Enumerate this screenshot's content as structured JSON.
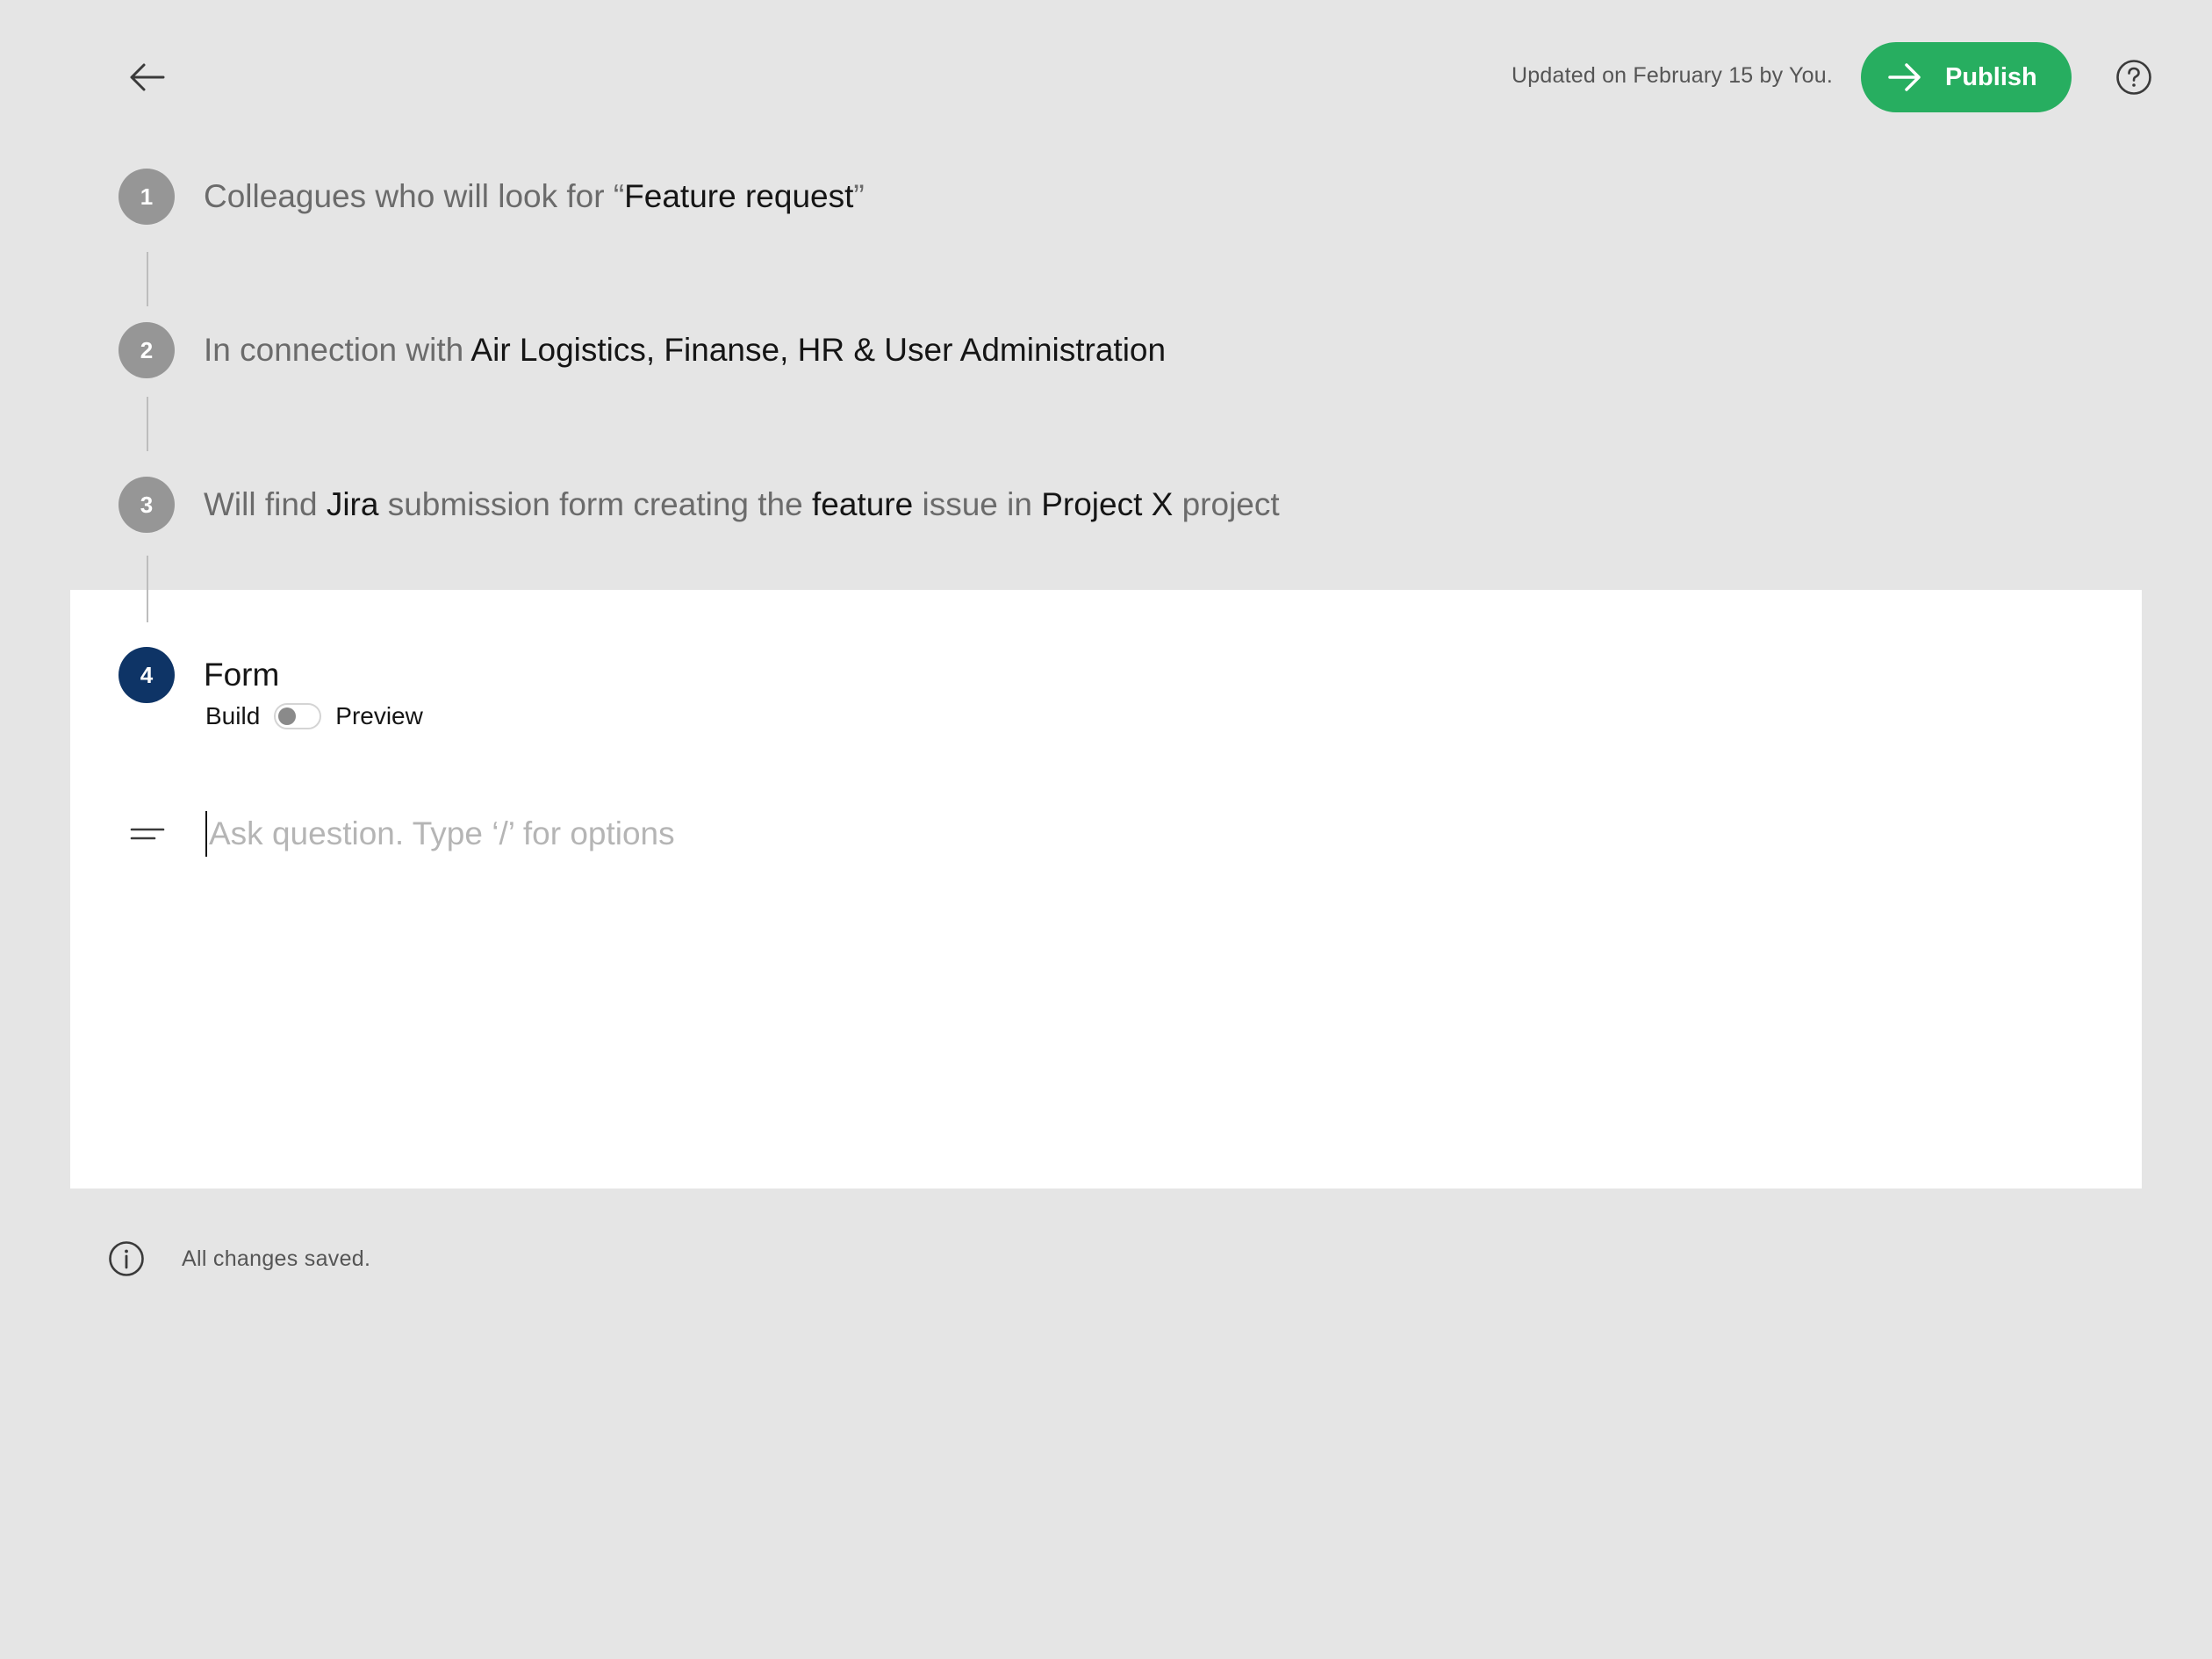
{
  "header": {
    "back_icon": "arrow-left-icon",
    "updated_text": "Updated on February 15 by You.",
    "publish_label": "Publish",
    "publish_icon": "arrow-right-icon",
    "help_icon": "question-circle-icon",
    "publish_color": "#27ae60"
  },
  "steps": [
    {
      "number": "1",
      "parts": [
        "Colleagues who will look for “",
        "Feature request",
        "”"
      ]
    },
    {
      "number": "2",
      "parts": [
        "In connection with ",
        "Air Logistics, Finanse, HR & User Administration"
      ]
    },
    {
      "number": "3",
      "parts": [
        "Will find ",
        "Jira",
        " submission form creating the ",
        "feature",
        " issue in ",
        "Project X",
        " project"
      ]
    },
    {
      "number": "4",
      "title": "Form"
    }
  ],
  "form": {
    "mode_build_label": "Build",
    "mode_preview_label": "Preview",
    "mode_toggle_on": false,
    "question_placeholder": "Ask question. Type ‘/’ for options",
    "question_value": "",
    "drag_icon": "drag-handle-icon"
  },
  "footer": {
    "info_icon": "info-circle-icon",
    "status_text": "All changes saved."
  },
  "colors": {
    "background": "#e5e5e5",
    "active_step": "#0e3466",
    "inactive_step": "#969696"
  }
}
